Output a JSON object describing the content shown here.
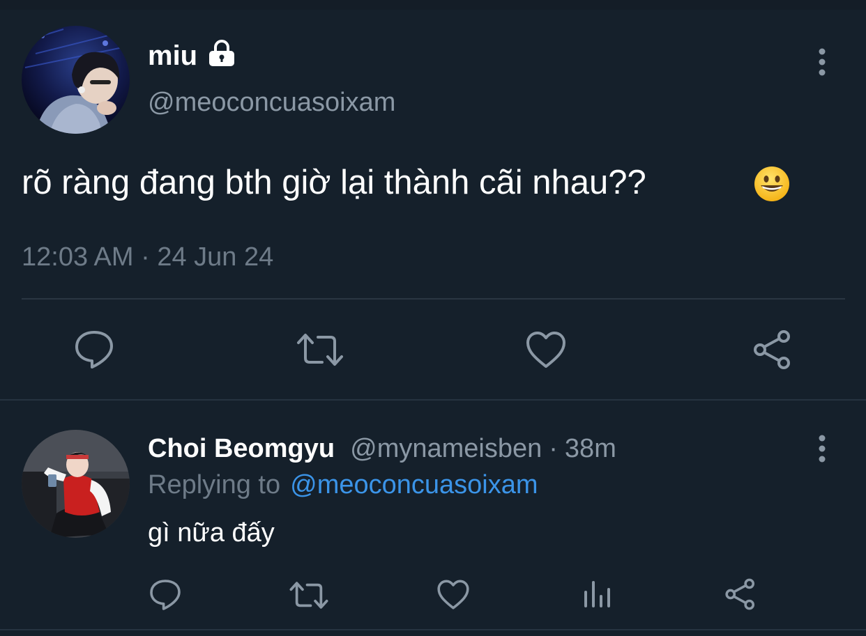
{
  "colors": {
    "background": "#15202b",
    "text_primary": "#ffffff",
    "text_secondary": "#8b98a5",
    "icon": "#8b98a5",
    "link": "#3b94e8",
    "divider": "#2a3642"
  },
  "main_tweet": {
    "author_name": "miu",
    "protected_icon": "lock-icon",
    "author_handle": "@meoconcuasoixam",
    "text": "rõ ràng đang bth giờ lại thành cãi nhau??",
    "emoji": "grinning-face-emoji",
    "meta": "12:03 AM · 24 Jun 24",
    "actions": [
      "reply-icon",
      "retweet-icon",
      "like-icon",
      "share-icon"
    ],
    "more_icon": "more-vertical-icon"
  },
  "reply_tweet": {
    "author_name": "Choi Beomgyu",
    "author_handle": "@mynameisben",
    "separator": "·",
    "time": "38m",
    "replying_prefix": "Replying to",
    "replying_to": "@meoconcuasoixam",
    "text": "gì nữa đấy",
    "actions": [
      "reply-icon",
      "retweet-icon",
      "like-icon",
      "analytics-icon",
      "share-icon"
    ],
    "more_icon": "more-vertical-icon"
  }
}
